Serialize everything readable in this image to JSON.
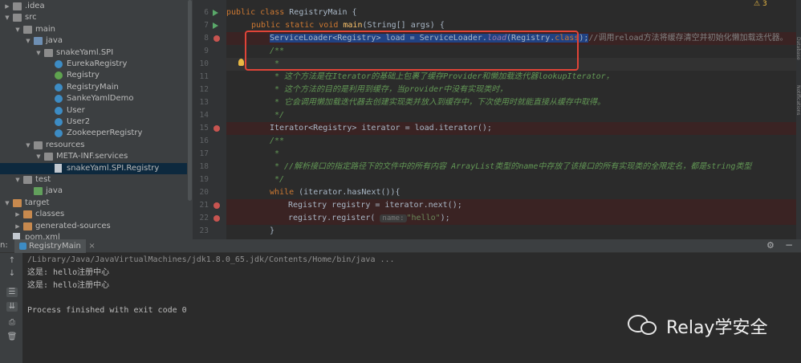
{
  "project_tree": {
    "items": [
      {
        "label": ".idea",
        "indent": 0,
        "expanded": false,
        "kind": "folder-gray"
      },
      {
        "label": "src",
        "indent": 0,
        "expanded": true,
        "kind": "folder-gray"
      },
      {
        "label": "main",
        "indent": 1,
        "expanded": true,
        "kind": "folder-gray"
      },
      {
        "label": "java",
        "indent": 2,
        "expanded": true,
        "kind": "folder-blue"
      },
      {
        "label": "snakeYaml.SPI",
        "indent": 3,
        "expanded": true,
        "kind": "folder-gray"
      },
      {
        "label": "EurekaRegistry",
        "indent": 4,
        "kind": "class"
      },
      {
        "label": "Registry",
        "indent": 4,
        "kind": "interface"
      },
      {
        "label": "RegistryMain",
        "indent": 4,
        "kind": "class"
      },
      {
        "label": "SankeYamlDemo",
        "indent": 4,
        "kind": "class"
      },
      {
        "label": "User",
        "indent": 4,
        "kind": "class"
      },
      {
        "label": "User2",
        "indent": 4,
        "kind": "class"
      },
      {
        "label": "ZookeeperRegistry",
        "indent": 4,
        "kind": "class"
      },
      {
        "label": "resources",
        "indent": 2,
        "expanded": true,
        "kind": "folder-gray"
      },
      {
        "label": "META-INF.services",
        "indent": 3,
        "expanded": true,
        "kind": "folder-gray"
      },
      {
        "label": "snakeYaml.SPI.Registry",
        "indent": 4,
        "kind": "file",
        "selected": true
      },
      {
        "label": "test",
        "indent": 1,
        "expanded": true,
        "kind": "folder-gray"
      },
      {
        "label": "java",
        "indent": 2,
        "kind": "folder-green"
      },
      {
        "label": "target",
        "indent": 0,
        "expanded": true,
        "kind": "folder-orange"
      },
      {
        "label": "classes",
        "indent": 1,
        "expanded": false,
        "kind": "folder-orange"
      },
      {
        "label": "generated-sources",
        "indent": 1,
        "expanded": false,
        "kind": "folder-orange"
      },
      {
        "label": "pom.xml",
        "indent": 0,
        "kind": "file"
      }
    ]
  },
  "editor": {
    "warning_count": "3",
    "lines": [
      {
        "num": "6",
        "marker": "run"
      },
      {
        "num": "7",
        "marker": "run"
      },
      {
        "num": "8",
        "marker": "breakpoint"
      },
      {
        "num": "9",
        "marker": ""
      },
      {
        "num": "10",
        "marker": ""
      },
      {
        "num": "11",
        "marker": ""
      },
      {
        "num": "12",
        "marker": ""
      },
      {
        "num": "13",
        "marker": ""
      },
      {
        "num": "14",
        "marker": ""
      },
      {
        "num": "15",
        "marker": "breakpoint"
      },
      {
        "num": "16",
        "marker": ""
      },
      {
        "num": "17",
        "marker": ""
      },
      {
        "num": "18",
        "marker": ""
      },
      {
        "num": "19",
        "marker": ""
      },
      {
        "num": "20",
        "marker": ""
      },
      {
        "num": "21",
        "marker": "breakpoint"
      },
      {
        "num": "22",
        "marker": "breakpoint"
      },
      {
        "num": "23",
        "marker": ""
      }
    ],
    "code": {
      "l6_kw1": "public class ",
      "l6_name": "RegistryMain {",
      "l7_kw": "public static void ",
      "l7_fn": "main",
      "l7_rest": "(String[] args) {",
      "l8_code_a": "ServiceLoader<Registry> load = ServiceLoader.",
      "l8_code_b": "load",
      "l8_code_c": "(Registry.",
      "l8_code_d": "class",
      "l8_code_e": ");",
      "l8_comment": "//调用reload方法将缓存清空并初始化懒加载迭代器。",
      "l9": "/**",
      "l10": " *",
      "l11_a": " * 这个方法是在",
      "l11_b": "Iterator",
      "l11_c": "的基础上包裹了缓存",
      "l11_d": "Provider",
      "l11_e": "和懒加载迭代器",
      "l11_f": "lookupIterator",
      "l11_g": "，",
      "l12_a": " * 这个方法的目的是利用到缓存，当",
      "l12_b": "provider",
      "l12_c": "中没有实现类时，",
      "l13": " * 它会调用懒加载迭代器去创建实现类并放入到缓存中，下次使用时就能直接从缓存中取得。",
      "l14": " */",
      "l15": "Iterator<Registry> iterator = load.iterator();",
      "l16": "/**",
      "l17": " *",
      "l18_a": " * //解析接口的指定路径下的文件中的所有内容 ",
      "l18_b": "ArrayList",
      "l18_c": "类型的",
      "l18_d": "name",
      "l18_e": "中存放了该接口的所有实现类的全限定名，都是",
      "l18_f": "string",
      "l18_g": "类型",
      "l19": " */",
      "l20_kw": "while",
      "l20_rest": " (iterator.hasNext()){",
      "l21": "Registry registry = iterator.next();",
      "l22_a": "registry.register(",
      "l22_hint": "name:",
      "l22_str": "\"hello\"",
      "l22_b": ");",
      "l23": "}"
    },
    "side_tabs": [
      "Database",
      "Notifications"
    ]
  },
  "run_panel": {
    "label": "n:",
    "tab_title": "RegistryMain",
    "close": "×",
    "java_path": "/Library/Java/JavaVirtualMachines/jdk1.8.0_65.jdk/Contents/Home/bin/java ...",
    "output": [
      "这是: hello注册中心",
      "这是: hello注册中心"
    ],
    "exit_message": "Process finished with exit code 0"
  },
  "watermark": {
    "text": "Relay学安全"
  }
}
